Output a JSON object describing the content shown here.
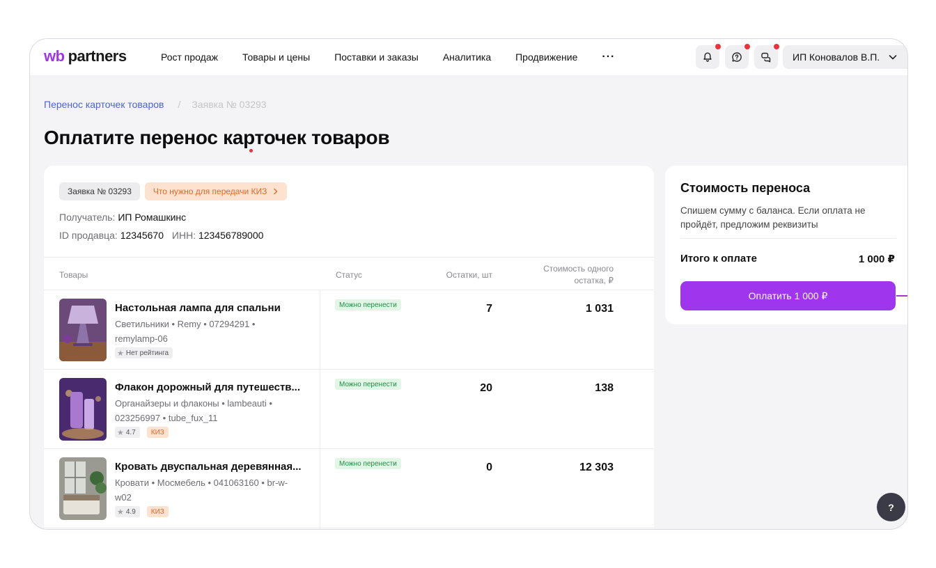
{
  "header": {
    "logo": {
      "wb": "wb",
      "partners": "partners"
    },
    "nav": [
      "Рост продаж",
      "Товары и цены",
      "Поставки и заказы",
      "Аналитика",
      "Продвижение"
    ],
    "more": "···",
    "user": "ИП Коновалов В.П."
  },
  "breadcrumb": {
    "link": "Перенос карточек товаров",
    "separator": "/",
    "current": "Заявка № 03293"
  },
  "page_title": "Оплатите перенос карточек товаров",
  "order": {
    "chip": "Заявка № 03293",
    "kiz_chip": "Что нужно для передачи КИЗ",
    "recipient_label": "Получатель:",
    "recipient": "ИП Ромашкинс",
    "seller_id_label": "ID продавца:",
    "seller_id": "12345670",
    "inn_label": "ИНН:",
    "inn": "123456789000"
  },
  "table": {
    "headers": {
      "goods": "Товары",
      "status": "Статус",
      "stock": "Остатки, шт",
      "price_line1": "Стоимость одного",
      "price_line2": "остатка, ₽"
    },
    "rows": [
      {
        "name": "Настольная лампа для спальни",
        "meta": "Светильники • Remy • 07294291 • remylamp-06",
        "rating": "Нет рейтинга",
        "kiz": "",
        "status": "Можно перенести",
        "stock": "7",
        "price": "1 031"
      },
      {
        "name": "Флакон дорожный для путешеств...",
        "meta": "Органайзеры и флаконы • lambeauti • 023256997 • tube_fux_11",
        "rating": "4.7",
        "kiz": "КИЗ",
        "status": "Можно перенести",
        "stock": "20",
        "price": "138"
      },
      {
        "name": "Кровать двуспальная деревянная...",
        "meta": "Кровати • Мосмебель • 041063160 • br-w-w02",
        "rating": "4.9",
        "kiz": "КИЗ",
        "status": "Можно перенести",
        "stock": "0",
        "price": "12 303"
      }
    ]
  },
  "side": {
    "title": "Стоимость переноса",
    "desc": "Спишем сумму с баланса. Если оплата не пройдёт, предложим реквизиты",
    "total_label": "Итого к оплате",
    "total_value": "1 000 ₽",
    "pay_button": "Оплатить 1 000 ₽"
  },
  "help": "?",
  "colors": {
    "accent": "#a035ee",
    "link": "#4a64d8",
    "status_green": "#1e8e46",
    "kiz_orange": "#e2682a",
    "notification": "#f0303a"
  },
  "icons": [
    "bell-icon",
    "support-icon",
    "chat-icon",
    "chevron-down-icon",
    "chevron-right-icon",
    "star-icon",
    "help-icon"
  ]
}
